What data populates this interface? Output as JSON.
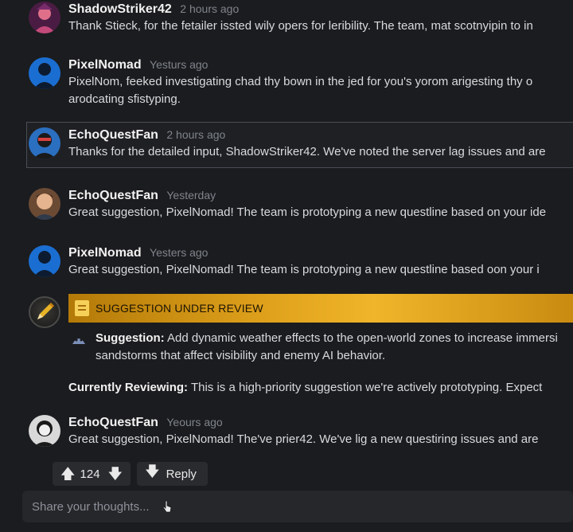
{
  "posts": [
    {
      "username": "ShadowStriker42",
      "time": "2 hours ago",
      "lines": [
        "Thank Stieck, for the fetailer issted wily opers for leribility. The team, mat scotnyipin to in"
      ]
    },
    {
      "username": "PixelNomad",
      "time": "Yesturs ago",
      "lines": [
        "PixelNom, feeked investigating chad thy bown in the jed for you's yorom arigesting thy o",
        "arodcating sfistyping."
      ]
    },
    {
      "username": "EchoQuestFan",
      "time": "2 hours ago",
      "lines": [
        "Thanks for the detailed input, ShadowStriker42. We've noted the server lag issues and are"
      ]
    },
    {
      "username": "EchoQuestFan",
      "time": "Yesterday",
      "lines": [
        "Great suggestion, PixelNomad! The team is prototyping a new questline based on your ide"
      ]
    },
    {
      "username": "PixelNomad",
      "time": "Yesters ago",
      "lines": [
        "Great suggestion, PixelNomad! The team is prototyping a new questline based oon your i"
      ]
    },
    {
      "username": "EchoQuestFan",
      "time": "Yeours ago",
      "lines": [
        "Great suggestion, PixelNomad! The've prier42. We've lig a new questiring issues and are"
      ]
    }
  ],
  "review": {
    "banner_title": "SUGGESTION UNDER REVIEW",
    "suggestion_label": "Suggestion:",
    "suggestion_line1": "Add dynamic weather effects to the open-world zones to increase immersi",
    "suggestion_line2": "sandstorms that affect visibility and enemy AI behavior.",
    "reviewing_label": "Currently Reviewing:",
    "reviewing_text": "This is a high-priority suggestion we're actively prototyping. Expect"
  },
  "actions": {
    "vote_count": "124",
    "reply_label": "Reply"
  },
  "composer": {
    "placeholder": "Share your thoughts..."
  },
  "icons": {
    "upvote": "arrow-up-icon",
    "downvote": "arrow-down-icon",
    "reply": "reply-arrow-icon",
    "banner": "clipboard-icon",
    "suggestion": "suggestion-icon",
    "cursor": "pointer-cursor-icon"
  },
  "colors": {
    "background": "#1b1c1f",
    "banner_gold": "#e0a21c",
    "muted_text": "#7f848c"
  }
}
